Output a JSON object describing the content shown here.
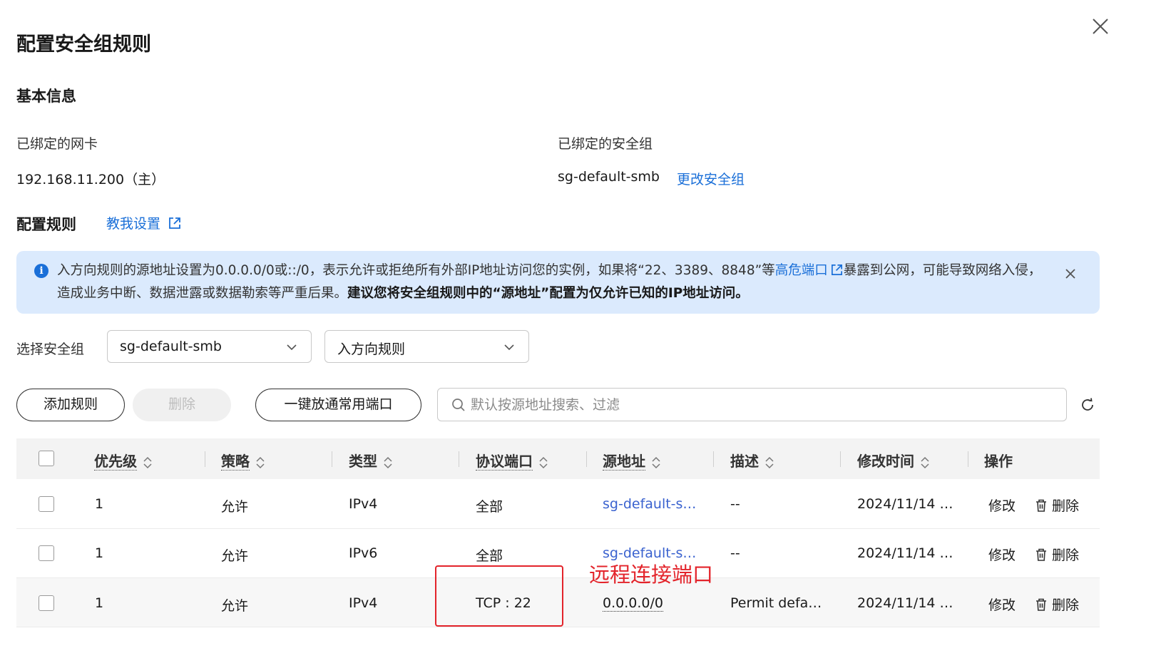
{
  "dialog": {
    "title": "配置安全组规则"
  },
  "basic_info": {
    "heading": "基本信息",
    "nic_label": "已绑定的网卡",
    "nic_value": "192.168.11.200（主）",
    "sg_label": "已绑定的安全组",
    "sg_value": "sg-default-smb",
    "change_sg_link": "更改安全组"
  },
  "rules_section": {
    "heading": "配置规则",
    "help_link": "教我设置"
  },
  "alert": {
    "text_part1": "入方向规则的源地址设置为0.0.0.0/0或::/0，表示允许或拒绝所有外部IP地址访问您的实例，如果将“22、3389、8848”等",
    "high_risk_link": "高危端口",
    "text_part2": "暴露到公网，可能导致网络入侵，造成业务中断、数据泄露或数据勒索等严重后果。",
    "text_bold": "建议您将安全组规则中的“源地址”配置为仅允许已知的IP地址访问。"
  },
  "filters": {
    "select_label": "选择安全组",
    "sg_select_value": "sg-default-smb",
    "direction_select_value": "入方向规则"
  },
  "toolbar": {
    "add_rule": "添加规则",
    "delete": "删除",
    "open_common_ports": "一键放通常用端口",
    "search_placeholder": "默认按源地址搜索、过滤"
  },
  "table": {
    "headers": {
      "priority": "优先级",
      "policy": "策略",
      "type": "类型",
      "protocol_port": "协议端口",
      "source": "源地址",
      "description": "描述",
      "modified_time": "修改时间",
      "actions": "操作"
    },
    "rows": [
      {
        "priority": "1",
        "policy": "允许",
        "type": "IPv4",
        "protocol_port": "全部",
        "source": "sg-default-s…",
        "description": "--",
        "modified_time": "2024/11/14 …",
        "edit": "修改",
        "delete": "删除"
      },
      {
        "priority": "1",
        "policy": "允许",
        "type": "IPv6",
        "protocol_port": "全部",
        "source": "sg-default-s…",
        "description": "--",
        "modified_time": "2024/11/14 …",
        "edit": "修改",
        "delete": "删除"
      },
      {
        "priority": "1",
        "policy": "允许",
        "type": "IPv4",
        "protocol_port": "TCP : 22",
        "source": "0.0.0.0/0",
        "description": "Permit defa…",
        "modified_time": "2024/11/14 …",
        "edit": "修改",
        "delete": "删除"
      }
    ]
  },
  "annotation": {
    "text": "远程连接端口",
    "color": "#e3242b"
  },
  "colors": {
    "link": "#1a6fd8",
    "alert_bg": "#dbeafd"
  }
}
